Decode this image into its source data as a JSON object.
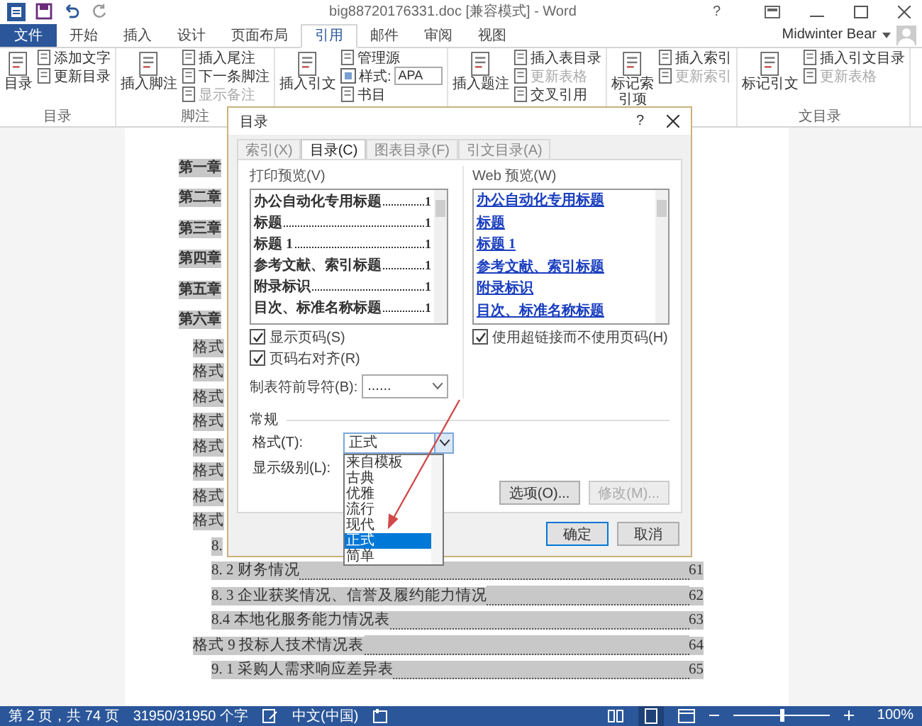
{
  "window": {
    "title": "big88720176331.doc [兼容模式] - Word",
    "help": "?"
  },
  "tabs": [
    {
      "label": "文件",
      "kind": "file",
      "selected": false
    },
    {
      "label": "开始",
      "kind": "tab",
      "selected": false
    },
    {
      "label": "插入",
      "kind": "tab",
      "selected": false
    },
    {
      "label": "设计",
      "kind": "tab",
      "selected": false
    },
    {
      "label": "页面布局",
      "kind": "tab",
      "selected": false
    },
    {
      "label": "引用",
      "kind": "tab",
      "selected": true
    },
    {
      "label": "邮件",
      "kind": "tab",
      "selected": false
    },
    {
      "label": "审阅",
      "kind": "tab",
      "selected": false
    },
    {
      "label": "视图",
      "kind": "tab",
      "selected": false
    }
  ],
  "user": {
    "name": "Midwinter Bear"
  },
  "ribbon_groups": [
    {
      "label": "目录",
      "items": [
        {
          "kind": "big",
          "label": "目录",
          "disabled": false
        },
        {
          "kind": "small",
          "label": "添加文字",
          "disabled": false
        },
        {
          "kind": "small",
          "label": "更新目录",
          "disabled": false
        }
      ]
    },
    {
      "label": "脚注",
      "items": [
        {
          "kind": "big",
          "label": "插入脚注",
          "disabled": false
        },
        {
          "kind": "small",
          "label": "插入尾注",
          "disabled": false
        },
        {
          "kind": "small",
          "label": "下一条脚注",
          "disabled": false
        },
        {
          "kind": "small",
          "label": "显示备注",
          "disabled": true
        }
      ]
    },
    {
      "items": [
        {
          "kind": "big",
          "label": "插入引文",
          "disabled": false
        },
        {
          "kind": "small",
          "label": "管理源",
          "disabled": false
        },
        {
          "kind": "select",
          "label": "样式:",
          "value": "APA",
          "disabled": false
        },
        {
          "kind": "small",
          "label": "书目",
          "disabled": false
        }
      ]
    },
    {
      "items": [
        {
          "kind": "big",
          "label": "插入题注",
          "disabled": false
        },
        {
          "kind": "small",
          "label": "插入表目录",
          "disabled": false
        },
        {
          "kind": "small",
          "label": "更新表格",
          "disabled": true
        },
        {
          "kind": "small",
          "label": "交叉引用",
          "disabled": false
        }
      ]
    },
    {
      "items": [
        {
          "kind": "big",
          "label": "标记索引项",
          "disabled": false
        },
        {
          "kind": "small",
          "label": "插入索引",
          "disabled": false
        },
        {
          "kind": "small",
          "label": "更新索引",
          "disabled": true
        }
      ]
    },
    {
      "label": "文目录",
      "items": [
        {
          "kind": "big",
          "label": "标记引文",
          "disabled": false
        },
        {
          "kind": "small",
          "label": "插入引文目录",
          "disabled": false
        },
        {
          "kind": "small",
          "label": "更新表格",
          "disabled": true
        }
      ]
    }
  ],
  "document": {
    "rows": [
      {
        "kind": "chapter",
        "text": "第一章"
      },
      {
        "kind": "chapter",
        "text": "第二章"
      },
      {
        "kind": "chapter",
        "text": "第三章"
      },
      {
        "kind": "chapter",
        "text": "第四章"
      },
      {
        "kind": "chapter",
        "text": "第五章"
      },
      {
        "kind": "chapter",
        "text": "第六章"
      },
      {
        "kind": "format",
        "text": "格式"
      },
      {
        "kind": "format",
        "text": "格式"
      },
      {
        "kind": "format",
        "text": "格式"
      },
      {
        "kind": "format",
        "text": "格式"
      },
      {
        "kind": "format",
        "text": "格式"
      },
      {
        "kind": "format",
        "text": "格式"
      },
      {
        "kind": "format",
        "text": "格式"
      },
      {
        "kind": "format",
        "text": "格式"
      },
      {
        "kind": "sub",
        "text": "8."
      },
      {
        "kind": "sub",
        "text": "8. 2 财务情况",
        "page": "61"
      },
      {
        "kind": "sub",
        "text": "8. 3  企业获奖情况、信誉及履约能力情况",
        "page": "62"
      },
      {
        "kind": "sub",
        "text": "8.4  本地化服务能力情况表",
        "page": "63"
      },
      {
        "kind": "format",
        "text": "格式 9  投标人技术情况表",
        "page": "64"
      },
      {
        "kind": "sub",
        "text": "9. 1 采购人需求响应差异表",
        "page": "65"
      }
    ]
  },
  "dialog": {
    "title": "目录",
    "help": "?",
    "tabs": [
      {
        "label": "索引(X)",
        "selected": false
      },
      {
        "label": "目录(C)",
        "selected": true
      },
      {
        "label": "图表目录(F)",
        "selected": false
      },
      {
        "label": "引文目录(A)",
        "selected": false
      }
    ],
    "print_preview": {
      "label": "打印预览(V)",
      "entries": [
        {
          "text": "办公自动化专用标题",
          "page": "1"
        },
        {
          "text": "标题",
          "page": "1"
        },
        {
          "text": "标题  1",
          "page": "1"
        },
        {
          "text": "参考文献、索引标题",
          "page": "1"
        },
        {
          "text": "附录标识",
          "page": "1"
        },
        {
          "text": "目次、标准名称标题",
          "page": "1"
        }
      ]
    },
    "show_page_numbers": {
      "label": "显示页码(S)",
      "checked": true
    },
    "right_align": {
      "label": "页码右对齐(R)",
      "checked": true
    },
    "tab_leader": {
      "label": "制表符前导符(B):",
      "value": "......"
    },
    "web_preview": {
      "label": "Web 预览(W)",
      "entries": [
        "办公自动化专用标题",
        "标题",
        "标题  1",
        "参考文献、索引标题",
        "附录标识",
        "目次、标准名称标题"
      ]
    },
    "use_hyperlinks": {
      "label": "使用超链接而不使用页码(H)",
      "checked": true
    },
    "general": {
      "label": "常规",
      "format_label": "格式(T):",
      "format_value": "正式",
      "levels_label": "显示级别(L):",
      "format_options": [
        {
          "label": "来自模板",
          "selected": false
        },
        {
          "label": "古典",
          "selected": false
        },
        {
          "label": "优雅",
          "selected": false
        },
        {
          "label": "流行",
          "selected": false
        },
        {
          "label": "现代",
          "selected": false
        },
        {
          "label": "正式",
          "selected": true
        },
        {
          "label": "简单",
          "selected": false
        }
      ]
    },
    "options_button": {
      "label": "选项(O)...",
      "disabled": false
    },
    "modify_button": {
      "label": "修改(M)...",
      "disabled": true
    },
    "ok": "确定",
    "cancel": "取消"
  },
  "status_bar": {
    "page": "第 2 页，共 74 页",
    "words": "31950/31950 个字",
    "language": "中文(中国)",
    "zoom": {
      "level": 0.5,
      "label": "100%"
    }
  }
}
